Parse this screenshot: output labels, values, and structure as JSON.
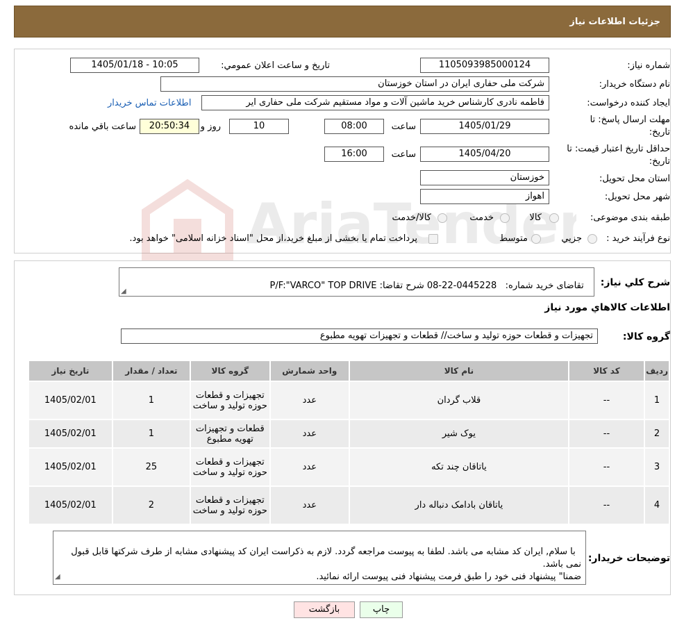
{
  "header": {
    "title": "جزئیات اطلاعات نیاز"
  },
  "fields": {
    "need_number_label": "شماره نیاز:",
    "need_number": "1105093985000124",
    "announce_label": "تاریخ و ساعت اعلان عمومي:",
    "announce_value": "1405/01/18 - 10:05",
    "buyer_org_label": "نام دستگاه خريدار:",
    "buyer_org": "شرکت ملی حفاری ایران در استان خوزستان",
    "creator_label": "ایجاد کننده درخواست:",
    "creator": "فاطمه نادری کارشناس خرید ماشین آلات و مواد مستقیم شرکت ملی حفاری ایر",
    "contact_link": "اطلاعات تماس خريدار",
    "deadline_label_1": "مهلت ارسال پاسخ: تا",
    "deadline_label_2": "تاریخ:",
    "deadline_date": "1405/01/29",
    "time_label": "ساعت",
    "deadline_time": "08:00",
    "days_value": "10",
    "days_label": "روز و",
    "remaining_value": "20:50:34",
    "remaining_label": "ساعت باقي مانده",
    "validity_label_1": "حداقل تاریخ اعتبار قیمت: تا",
    "validity_label_2": "تاریخ:",
    "validity_date": "1405/04/20",
    "validity_time": "16:00",
    "province_label": "استان محل تحویل:",
    "province": "خوزستان",
    "city_label": "شهر محل تحویل:",
    "city": "اهواز",
    "category_label": "طبقه بندی موضوعی:",
    "category_options": [
      "کالا",
      "خدمت",
      "کالا/خدمت"
    ],
    "process_label": "نوع فرآیند خرید :",
    "process_options": [
      "جزيي",
      "متوسط"
    ],
    "process_note": "پرداخت تمام يا بخشی از مبلغ خريد،از محل \"اسناد خزانه اسلامی\" خواهد بود."
  },
  "description": {
    "label": "شرح كلي نياز:",
    "text": "تقاضای خرید شماره:   0445228-22-08 شرح تقاضا: P/F:\"VARCO\" TOP DRIVE"
  },
  "goods": {
    "section_title": "اطلاعات کالاهاي مورد نياز",
    "group_label": "گروه کالا:",
    "group_value": "تجهیزات و قطعات حوزه تولید و ساخت//  قطعات و تجهیزات تهویه مطبوع"
  },
  "table": {
    "headers": [
      "رديف",
      "کد کالا",
      "نام کالا",
      "واحد شمارش",
      "گروه کالا",
      "تعداد / مقدار",
      "تاریخ نیاز"
    ],
    "rows": [
      [
        "1",
        "--",
        "قلاب گردان",
        "عدد",
        "تجهیزات و قطعات حوزه تولید و ساخت",
        "1",
        "1405/02/01"
      ],
      [
        "2",
        "--",
        "یوک شیر",
        "عدد",
        "قطعات و تجهیزات تهویه مطبوع",
        "1",
        "1405/02/01"
      ],
      [
        "3",
        "--",
        "یاتاقان چند تکه",
        "عدد",
        "تجهیزات و قطعات حوزه تولید و ساخت",
        "25",
        "1405/02/01"
      ],
      [
        "4",
        "--",
        "یاتاقان بادامک دنباله دار",
        "عدد",
        "تجهیزات و قطعات حوزه تولید و ساخت",
        "2",
        "1405/02/01"
      ]
    ]
  },
  "buyer_notes": {
    "label": "توضیحات خریدار:",
    "text": "با سلام, ایران کد مشابه می باشد. لطفا به پیوست مراجعه گردد. لازم به ذکراست ایران کد پیشنهادی مشابه از طرف شرکتها قابل قبول نمی باشد.\nضمنا\" پیشنهاد فنی خود را طبق فرمت پیشنهاد فنی پیوست ارائه نمائید."
  },
  "buttons": {
    "print": "چاپ",
    "back": "بازگشت"
  },
  "colors": {
    "header_bg": "#8b6a3c",
    "link": "#1a5fb4",
    "back_button": "#ffe3e3",
    "print_button": "#eaffea"
  }
}
